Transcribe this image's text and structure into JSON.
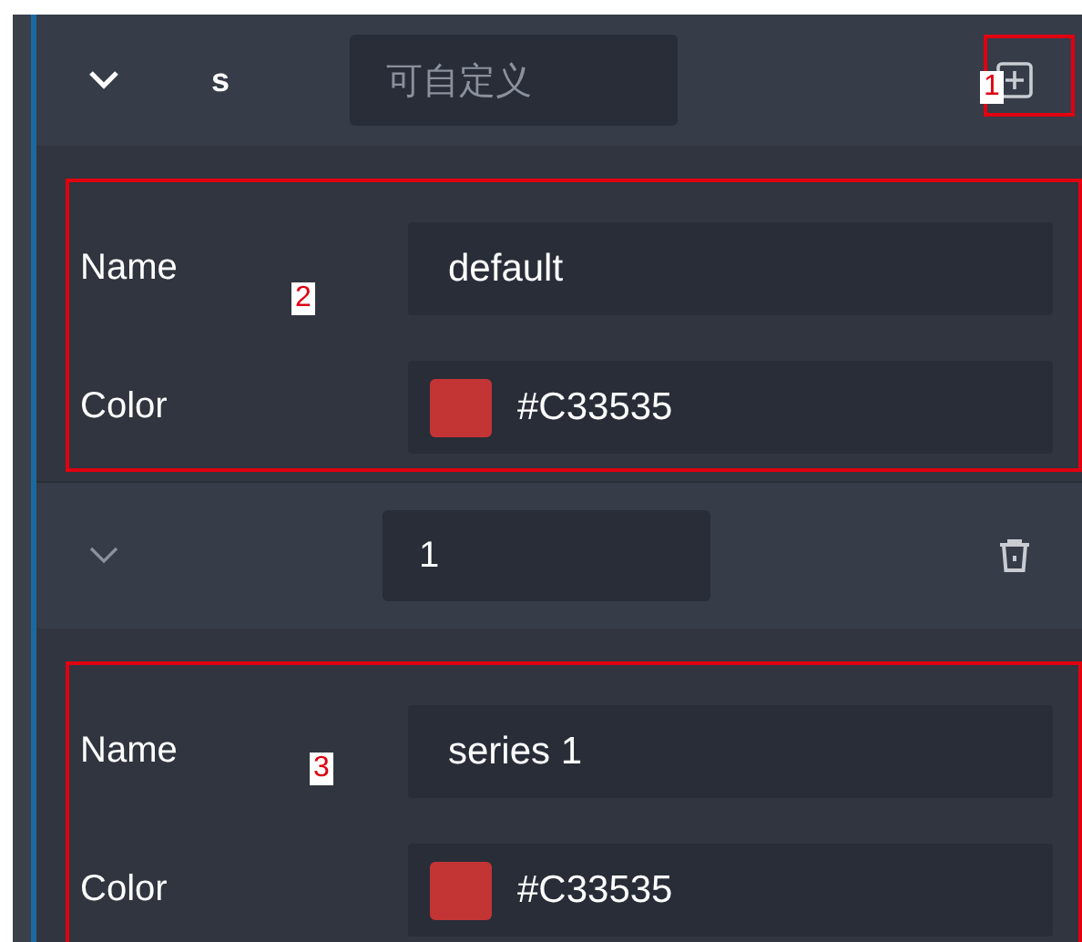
{
  "groups": [
    {
      "header": {
        "title": "s",
        "active": true,
        "input": {
          "placeholder": "可自定义"
        },
        "action": {
          "kind": "add",
          "annotation": "1"
        }
      },
      "body": {
        "annotation": "2",
        "fields": [
          {
            "kind": "text",
            "label": "Name",
            "value": "default"
          },
          {
            "kind": "color",
            "label": "Color",
            "value": "#C33535",
            "color": "#c33535"
          }
        ]
      }
    },
    {
      "header": {
        "active": false,
        "input": {
          "value": "1"
        },
        "action": {
          "kind": "delete"
        }
      },
      "body": {
        "annotation": "3",
        "fields": [
          {
            "kind": "text",
            "label": "Name",
            "value": "series 1"
          },
          {
            "kind": "color",
            "label": "Color",
            "value": "#C33535",
            "color": "#c33535"
          }
        ]
      }
    }
  ]
}
